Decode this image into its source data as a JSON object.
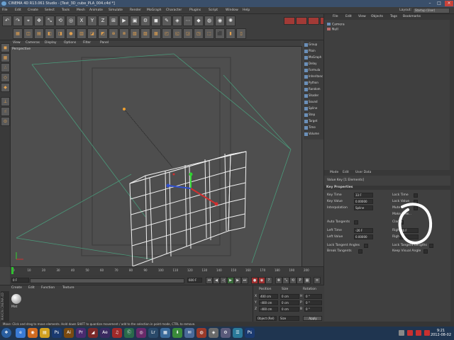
{
  "window": {
    "title": "CINEMA 4D R13.061 Studio - [Test_3D_cube_PLA_004.c4d *]"
  },
  "menu": [
    "File",
    "Edit",
    "Create",
    "Select",
    "Tools",
    "Mesh",
    "Animate",
    "Simulate",
    "Render",
    "MoGraph",
    "Character",
    "Plugins",
    "Script",
    "Window",
    "Help"
  ],
  "layout": {
    "label": "Layout:",
    "value": "Startup (User)"
  },
  "toolbar1": {
    "icons": [
      "undo",
      "redo",
      "select",
      "move",
      "scale",
      "rotate",
      "live",
      "x-axis",
      "y-axis",
      "z-axis",
      "coord",
      "render-view",
      "render-pic",
      "render-settings",
      "cube",
      "pen",
      "subdiv",
      "array",
      "deformer",
      "scene",
      "camera",
      "light"
    ],
    "labels": [
      "↶",
      "↷",
      "⌖",
      "✥",
      "⤡",
      "⟲",
      "◎",
      "X",
      "Y",
      "Z",
      "⊞",
      "▶",
      "▣",
      "⚙",
      "◼",
      "✎",
      "◈",
      "⋯",
      "◆",
      "◍",
      "◉",
      "✺"
    ]
  },
  "toolbar2": {
    "labels": [
      "▦",
      "◫",
      "▤",
      "◧",
      "◨",
      "●",
      "▥",
      "◪",
      "◩",
      "⊕",
      "⊗",
      "▧",
      "▨",
      "▩",
      "◰",
      "◱",
      "◲",
      "◳",
      "⬚",
      "⬛",
      "▮",
      "▯"
    ]
  },
  "viewport_menu": [
    "View",
    "Cameras",
    "Display",
    "Options",
    "Filter",
    "Panel"
  ],
  "viewport_label": "Perspective",
  "object_palette": [
    "Group",
    "Plain",
    "MoGraph",
    "Delay",
    "Formula",
    "Inheritance",
    "Python",
    "Random",
    "Shader",
    "Sound",
    "Spline",
    "Step",
    "Target",
    "Time",
    "Volume"
  ],
  "object_manager": {
    "menu": [
      "File",
      "Edit",
      "View",
      "Objects",
      "Tags",
      "Bookmarks"
    ],
    "objects": [
      {
        "name": "Camera",
        "color": "#6b8fb8"
      },
      {
        "name": "Null",
        "color": "#b86b6b"
      }
    ]
  },
  "attribute_manager": {
    "menu": [
      "Mode",
      "Edit",
      "User Data"
    ],
    "title": "Value Key [1 Elements]",
    "section": "Key Properties",
    "fields": {
      "key_time_label": "Key Time",
      "key_time_value": "33 F",
      "lock_time_label": "Lock Time",
      "key_value_label": "Key Value",
      "key_value_value": "0.00000",
      "lock_value_label": "Lock Value",
      "interpolation_label": "Interpolation",
      "interpolation_value": "Spline",
      "mute_label": "Mute",
      "make_new_label": "Make New...",
      "auto_tangents_label": "Auto Tangents",
      "clamp_label": "Clamp",
      "left_time_label": "Left Time",
      "left_time_value": "-26 F",
      "right_time_label": "Right Time",
      "right_time_value": "26 F",
      "left_value_label": "Left Value",
      "left_value_value": "0.00000",
      "right_value_label": "Right Value",
      "lock_tangent_angles_label": "Lock Tangent Angles",
      "lock_tangent_lengths_label": "Lock Tangent Lengths",
      "break_tangents_label": "Break Tangents",
      "keep_visual_angle_label": "Keep Visual Angle"
    }
  },
  "timeline": {
    "ticks": [
      "0",
      "10",
      "20",
      "30",
      "40",
      "50",
      "60",
      "70",
      "80",
      "90",
      "100",
      "110",
      "120",
      "130",
      "140",
      "150",
      "160",
      "170",
      "180",
      "190",
      "200"
    ],
    "current_frame": "0 F",
    "end_frame": "600 F",
    "start_frame": "0 F"
  },
  "material_manager": {
    "menu": [
      "Create",
      "Edit",
      "Function",
      "Texture"
    ],
    "material": "Mat",
    "brand": "MAXON CINEMA 4D"
  },
  "coordinates": {
    "headers": [
      "Position",
      "Size",
      "Rotation"
    ],
    "rows": [
      {
        "axis": "X",
        "pos": "400 cm",
        "size": "0 cm",
        "rot_axis": "H",
        "rot": "0 °"
      },
      {
        "axis": "Y",
        "pos": "-400 cm",
        "size": "0 cm",
        "rot_axis": "P",
        "rot": "0 °"
      },
      {
        "axis": "Z",
        "pos": "-400 cm",
        "size": "0 cm",
        "rot_axis": "B",
        "rot": "0 °"
      }
    ],
    "mode": "Object (Rel)",
    "size_mode": "Size",
    "apply": "Apply"
  },
  "status": "Move: Click and drag to move elements. Hold down SHIFT to quantize movement / add to the selection in point mode, CTRL to remove.",
  "taskbar": {
    "apps": [
      {
        "label": "❖",
        "color": "#2a5fa0"
      },
      {
        "label": "e",
        "color": "#3a7bd5"
      },
      {
        "label": "◉",
        "color": "#d06a20"
      },
      {
        "label": "▤",
        "color": "#d0a020"
      },
      {
        "label": "Ps",
        "color": "#1a3a70"
      },
      {
        "label": "Ai",
        "color": "#7a4a10"
      },
      {
        "label": "Pr",
        "color": "#4a2a70"
      },
      {
        "label": "◢",
        "color": "#7a2a2a"
      },
      {
        "label": "Ae",
        "color": "#3a2a60"
      },
      {
        "label": "♫",
        "color": "#a02a2a"
      },
      {
        "label": "Ⓒ",
        "color": "#2a6a4a"
      },
      {
        "label": "◎",
        "color": "#6a2a6a"
      },
      {
        "label": "Lr",
        "color": "#2a4a6a"
      },
      {
        "label": "▦",
        "color": "#3a6a9a"
      },
      {
        "label": "⬇",
        "color": "#3a8a3a"
      },
      {
        "label": "✉",
        "color": "#4a6a9a"
      },
      {
        "label": "◍",
        "color": "#9a3a2a"
      },
      {
        "label": "◈",
        "color": "#6a6a6a"
      },
      {
        "label": "⚙",
        "color": "#5a5a7a"
      },
      {
        "label": "☰",
        "color": "#2a7a9a"
      },
      {
        "label": "Ps",
        "color": "#1a3a70"
      }
    ],
    "time": "9:21",
    "date": "2012-08-02"
  }
}
